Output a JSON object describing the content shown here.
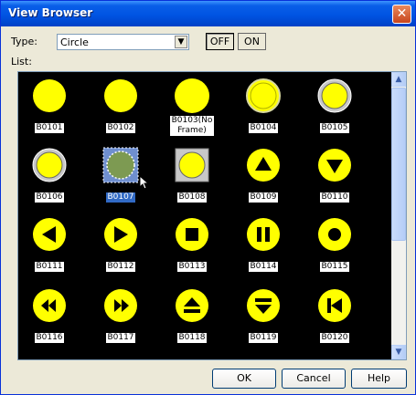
{
  "window": {
    "title": "View Browser",
    "close_glyph": "✕"
  },
  "type_label": "Type:",
  "type_select": {
    "value": "Circle",
    "arrow": "▼"
  },
  "toggle": {
    "off_label": "OFF",
    "on_label": "ON",
    "selected": "OFF"
  },
  "list_label": "List:",
  "colors": {
    "icon_yellow": "#ffff00",
    "grid_bg": "#000000",
    "selection": "#316ac5",
    "title_bar": "#0054e3"
  },
  "items": [
    {
      "label": "B0101",
      "icon": "circle-plain"
    },
    {
      "label": "B0102",
      "icon": "circle-plain"
    },
    {
      "label": "B0103(No Frame)",
      "icon": "circle-no-frame"
    },
    {
      "label": "B0104",
      "icon": "circle-framed"
    },
    {
      "label": "B0105",
      "icon": "circle-framed-gray"
    },
    {
      "label": "B0106",
      "icon": "circle-framed-gray"
    },
    {
      "label": "B0107",
      "icon": "circle-selected",
      "selected": true
    },
    {
      "label": "B0108",
      "icon": "circle-framed-square"
    },
    {
      "label": "B0109",
      "icon": "triangle-up"
    },
    {
      "label": "B0110",
      "icon": "triangle-down"
    },
    {
      "label": "B0111",
      "icon": "triangle-left"
    },
    {
      "label": "B0112",
      "icon": "triangle-right"
    },
    {
      "label": "B0113",
      "icon": "square-stop"
    },
    {
      "label": "B0114",
      "icon": "pause"
    },
    {
      "label": "B0115",
      "icon": "ring"
    },
    {
      "label": "B0116",
      "icon": "rewind"
    },
    {
      "label": "B0117",
      "icon": "fast-forward"
    },
    {
      "label": "B0118",
      "icon": "eject"
    },
    {
      "label": "B0119",
      "icon": "eject-down"
    },
    {
      "label": "B0120",
      "icon": "skip-back"
    }
  ],
  "buttons": {
    "ok": "OK",
    "cancel": "Cancel",
    "help": "Help"
  },
  "scroll": {
    "up": "▲",
    "down": "▼",
    "position": 0
  }
}
